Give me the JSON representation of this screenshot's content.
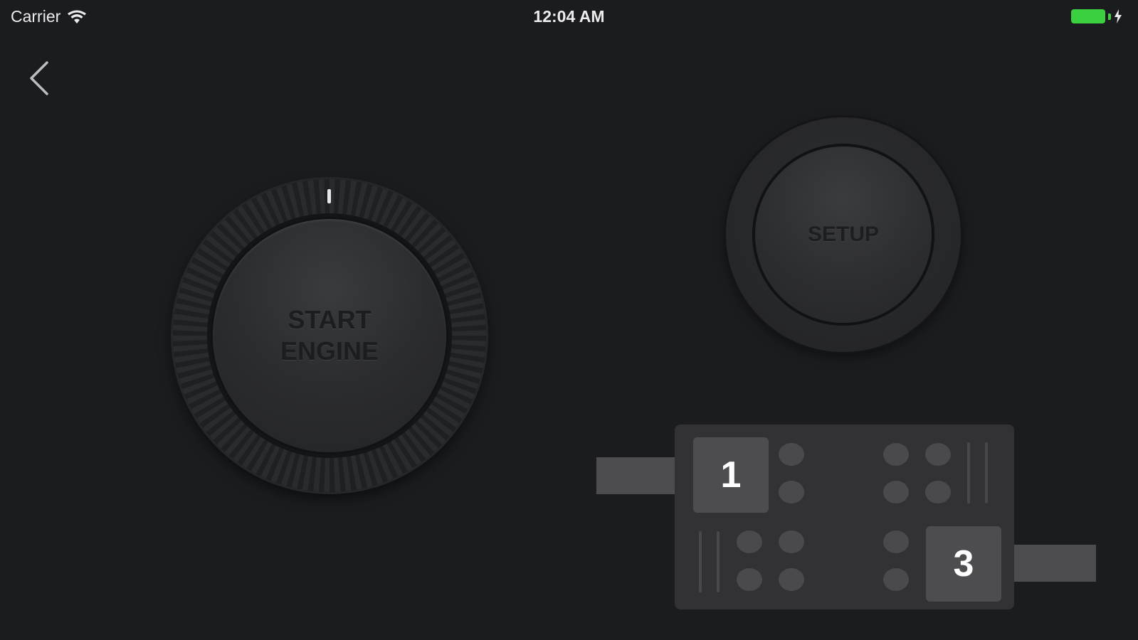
{
  "status_bar": {
    "carrier": "Carrier",
    "time": "12:04 AM",
    "battery_color": "#3ad03f",
    "wifi_icon": "wifi-icon",
    "charge_icon": "charging-bolt-icon"
  },
  "nav": {
    "back_icon": "chevron-left-icon"
  },
  "engine": {
    "line1": "START",
    "line2": "ENGINE"
  },
  "setup": {
    "label": "SETUP"
  },
  "gears": {
    "gear_1": "1",
    "gear_3": "3"
  }
}
